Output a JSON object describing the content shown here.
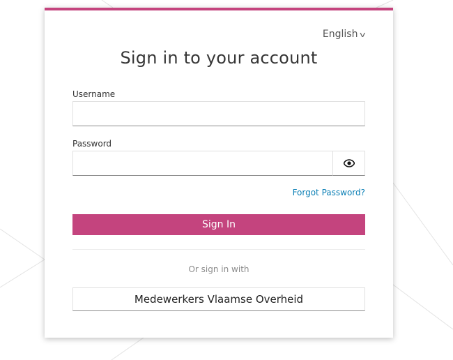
{
  "language": {
    "selected": "English",
    "chevron": "v"
  },
  "title": "Sign in to your account",
  "username": {
    "label": "Username",
    "value": ""
  },
  "password": {
    "label": "Password",
    "value": "",
    "toggle_icon": "eye-icon"
  },
  "forgot_password": "Forgot Password?",
  "sign_in_label": "Sign In",
  "or_sign_in_with": "Or sign in with",
  "identity_provider_label": "Medewerkers Vlaamse Overheid",
  "colors": {
    "accent": "#c4447e",
    "link": "#0a7fb5"
  }
}
